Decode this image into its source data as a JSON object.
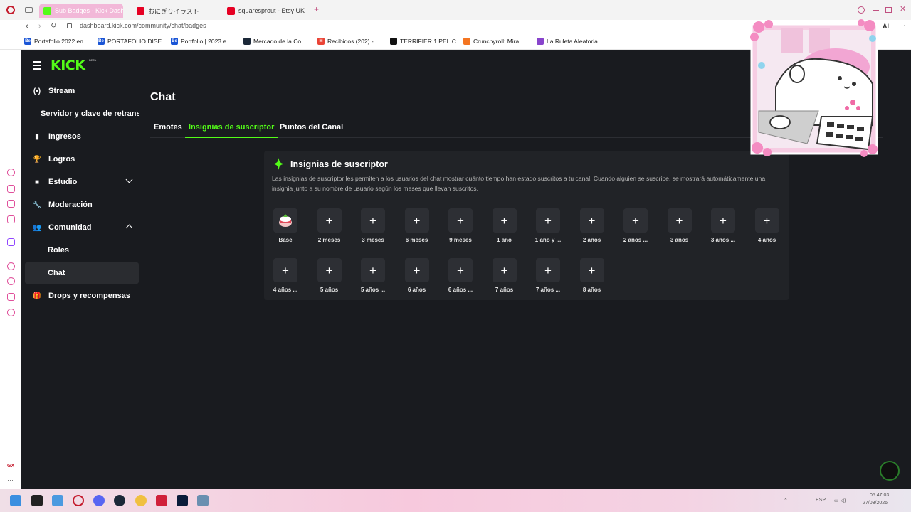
{
  "browser": {
    "tabs": [
      {
        "title": "Sub Badges - Kick Dashb",
        "color": "#53fc18",
        "active": true
      },
      {
        "title": "おにぎりイラスト",
        "color": "#e60023",
        "active": false
      },
      {
        "title": "squaresprout - Etsy UK",
        "color": "#e60023",
        "active": false
      }
    ],
    "new_tab": "+",
    "url": "dashboard.kick.com/community/chat/badges",
    "bookmarks": [
      {
        "label": "Portafolio 2022 en...",
        "color": "#1a55d6",
        "glyph": "Be"
      },
      {
        "label": "PORTAFOLIO DISE...",
        "color": "#1a55d6",
        "glyph": "Be"
      },
      {
        "label": "Portfolio | 2023 e...",
        "color": "#1a55d6",
        "glyph": "Be"
      },
      {
        "label": "Mercado de la Co...",
        "color": "#1b2838",
        "glyph": ""
      },
      {
        "label": "Recibidos (202) -...",
        "color": "#ea4335",
        "glyph": "M"
      },
      {
        "label": "TERRIFIER 1 PELIC...",
        "color": "#111111",
        "glyph": ""
      },
      {
        "label": "Crunchyroll: Mira...",
        "color": "#f47521",
        "glyph": ""
      },
      {
        "label": "La Ruleta Aleatoria",
        "color": "#8844cc",
        "glyph": ""
      }
    ],
    "ai_label": "AI"
  },
  "app": {
    "logo": "KICK",
    "beta": "BETA",
    "nav": [
      {
        "label": "Stream",
        "icon": "broadcast-icon",
        "glyph": "(•)",
        "sub": false
      },
      {
        "label": "Servidor y clave de retransmisión",
        "icon": "",
        "glyph": "",
        "sub": true
      },
      {
        "label": "Ingresos",
        "icon": "bar-chart-icon",
        "glyph": "▮",
        "sub": false
      },
      {
        "label": "Logros",
        "icon": "trophy-icon",
        "glyph": "🏆",
        "sub": false
      },
      {
        "label": "Estudio",
        "icon": "video-icon",
        "glyph": "■",
        "sub": false,
        "chevron": "down"
      },
      {
        "label": "Moderación",
        "icon": "wrench-icon",
        "glyph": "🔧",
        "sub": false
      },
      {
        "label": "Comunidad",
        "icon": "people-icon",
        "glyph": "👥",
        "sub": false,
        "chevron": "up"
      },
      {
        "label": "Roles",
        "icon": "",
        "glyph": "",
        "sub": true
      },
      {
        "label": "Chat",
        "icon": "",
        "glyph": "",
        "sub": true,
        "selected": true
      },
      {
        "label": "Drops y recompensas",
        "icon": "gift-icon",
        "glyph": "🎁",
        "sub": false
      }
    ],
    "page_title": "Chat",
    "tabs": [
      {
        "label": "Emotes",
        "active": false
      },
      {
        "label": "Insignias de suscriptor",
        "active": true
      },
      {
        "label": "Puntos del Canal",
        "active": false
      }
    ],
    "card": {
      "title": "Insignias de suscriptor",
      "description": "Las insignias de suscriptor les permiten a los usuarios del chat mostrar cuánto tiempo han estado suscritos a tu canal. Cuando alguien se suscribe, se mostrará automáticamente una insignia junto a su nombre de usuario según los meses que llevan suscritos."
    },
    "badges_row1": [
      "Base",
      "2 meses",
      "3 meses",
      "6 meses",
      "9 meses",
      "1 año",
      "1 año y ...",
      "2 años",
      "2 años ...",
      "3 años",
      "3 años ...",
      "4 años"
    ],
    "badges_row2": [
      "4 años ...",
      "5 años",
      "5 años ...",
      "6 años",
      "6 años ...",
      "7 años",
      "7 años ...",
      "8 años"
    ],
    "add_glyph": "+",
    "accent": "#53fc18"
  },
  "taskbar": {
    "lang": "ESP",
    "time": "05:47:03",
    "date": "27/03/2026"
  }
}
